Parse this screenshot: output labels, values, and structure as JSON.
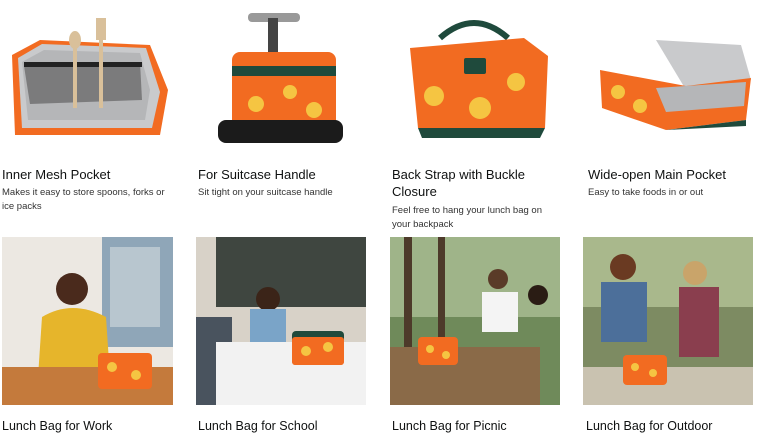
{
  "features": [
    {
      "title": "Inner Mesh Pocket",
      "description": "Makes it easy to store spoons, forks or ice packs",
      "image_icon": "mesh-pocket-photo"
    },
    {
      "title": "For Suitcase Handle",
      "description": "Sit tight on your suitcase handle",
      "image_icon": "suitcase-handle-photo"
    },
    {
      "title": "Back Strap with Buckle Closure",
      "description": "Feel free to hang your lunch bag on your backpack",
      "image_icon": "back-strap-photo"
    },
    {
      "title": "Wide-open Main Pocket",
      "description": "Easy to take foods in or out",
      "image_icon": "main-pocket-photo"
    }
  ],
  "scenes": [
    {
      "caption": "Lunch Bag for Work",
      "image_icon": "office-scene-photo"
    },
    {
      "caption": "Lunch Bag for School",
      "image_icon": "classroom-scene-photo"
    },
    {
      "caption": "Lunch Bag for Picnic",
      "image_icon": "picnic-scene-photo"
    },
    {
      "caption": "Lunch Bag for Outdoor",
      "image_icon": "outdoor-scene-photo"
    }
  ],
  "colors": {
    "bag_orange": "#f26b21",
    "bag_green": "#1f4a3c",
    "pineapple": "#f5c542",
    "silver": "#c9cacc"
  }
}
